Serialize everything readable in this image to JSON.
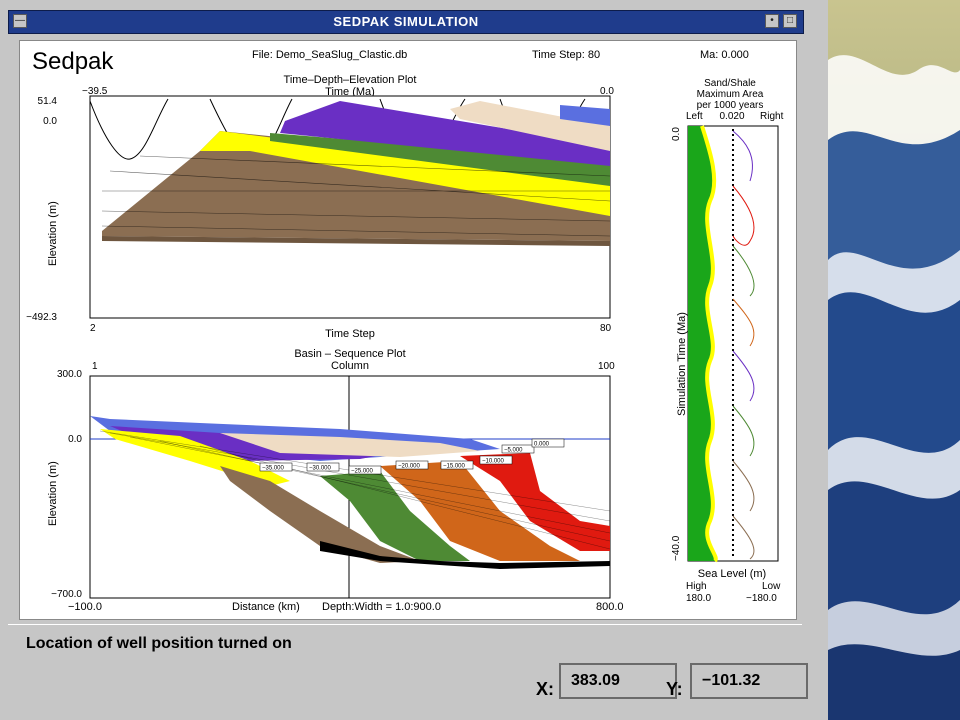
{
  "window": {
    "title": "SEDPAK SIMULATION",
    "colors": {
      "titlebar": "#1f3c8c",
      "frame": "#c6c6c6"
    }
  },
  "header": {
    "app_name": "Sedpak",
    "file": "File: Demo_SeaSlug_Clastic.db",
    "time_step": "Time Step:  80",
    "ma": "Ma: 0.000"
  },
  "plot1": {
    "title": "Time–Depth–Elevation Plot",
    "top_axis_label": "Time (Ma)",
    "top_left_tick": "−39.5",
    "top_right_tick": "0.0",
    "y_top_tick": "51.4",
    "y_zero_tick": "0.0",
    "y_bottom_tick": "−492.3",
    "y_label": "Elevation (m)",
    "x_left_tick": "2",
    "x_right_tick": "80",
    "x_label": "Time Step"
  },
  "plot2": {
    "title": "Basin – Sequence Plot",
    "top_axis_label": "Column",
    "top_left_tick": "1",
    "top_right_tick": "100",
    "y_top_tick": "300.0",
    "y_zero_tick": "0.0",
    "y_bottom_tick": "−700.0",
    "y_label": "Elevation (m)",
    "x_left_tick": "−100.0",
    "x_right_tick": "800.0",
    "x_label": "Distance (km)",
    "depth_width": "Depth:Width = 1.0:900.0",
    "sequence_labels": [
      "−35.000",
      "−30.000",
      "−25.000",
      "−20.000",
      "−15.000",
      "−10.000",
      "−5.000",
      "0.000"
    ]
  },
  "side_panel": {
    "title_line1": "Sand/Shale",
    "title_line2": "Maximum Area",
    "title_line3": "per 1000 years",
    "left_label": "Left",
    "area_value": "0.020",
    "right_label": "Right",
    "y_top_tick": "0.0",
    "y_bottom_tick": "−40.0",
    "y_label": "Simulation Time (Ma)",
    "x_label": "Sea Level (m)",
    "high_label": "High",
    "low_label": "Low",
    "high_value": "180.0",
    "low_value": "−180.0"
  },
  "status": {
    "message": "Location of well position turned on",
    "x_label": "X:",
    "x_value": "383.09",
    "y_label": "Y:",
    "y_value": "−101.32"
  },
  "layer_colors": {
    "brown": "#8b6e52",
    "yellow": "#ffff00",
    "green": "#4e8a34",
    "purple": "#6a2fc4",
    "tan": "#efdcc4",
    "blue": "#5a6fe0",
    "orange": "#d0661a",
    "red": "#e01a10"
  }
}
